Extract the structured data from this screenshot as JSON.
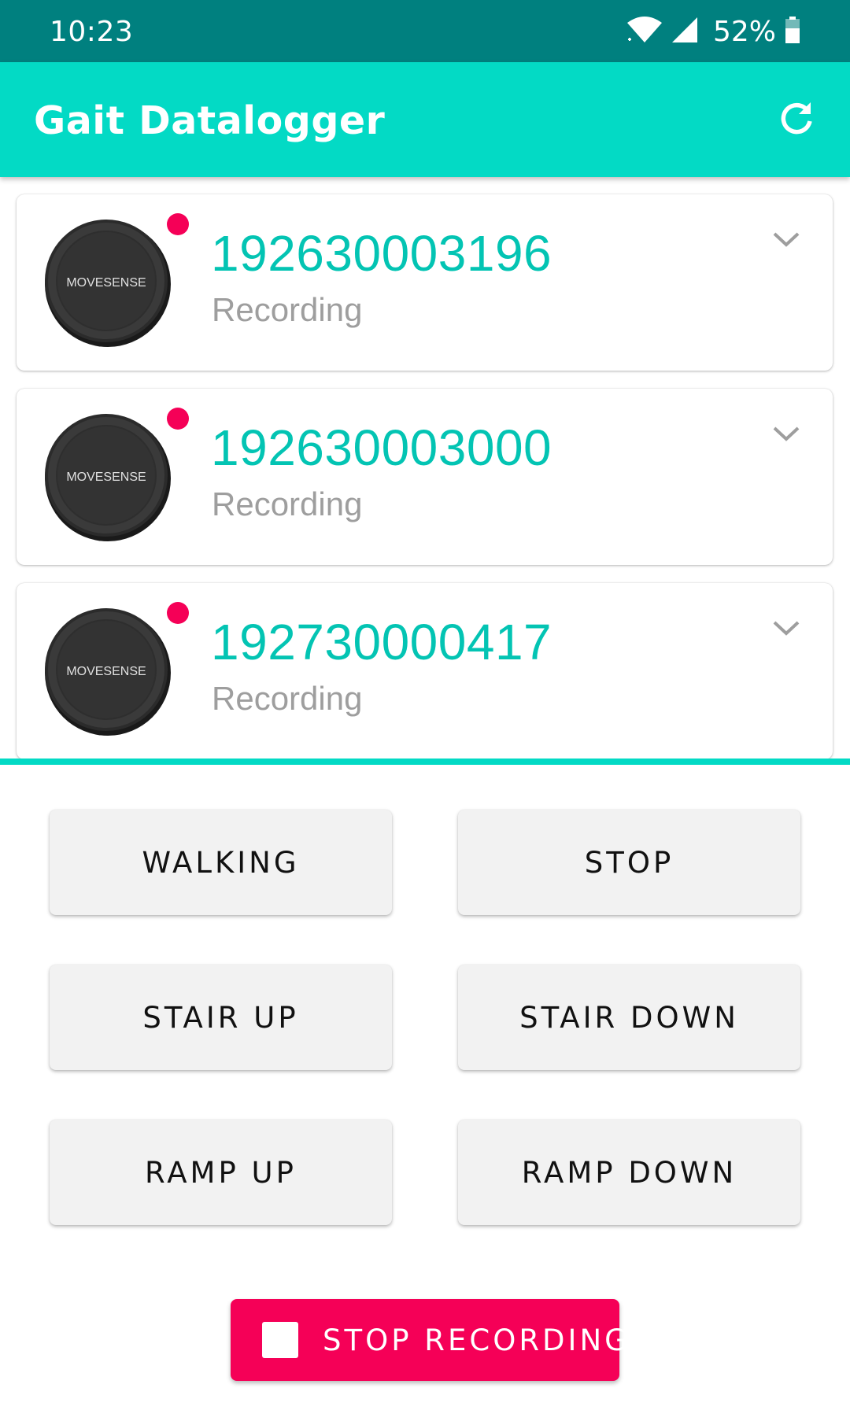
{
  "status_bar": {
    "time": "10:23",
    "battery_percent": "52%",
    "wifi_icon": "wifi-icon",
    "signal_icon": "cell-signal-icon",
    "battery_icon": "battery-icon"
  },
  "app_bar": {
    "title": "Gait Datalogger",
    "refresh_icon": "refresh-icon"
  },
  "devices": [
    {
      "serial": "192630003196",
      "status": "Recording",
      "brand_logo": "MOVESENSE"
    },
    {
      "serial": "192630003000",
      "status": "Recording",
      "brand_logo": "MOVESENSE"
    },
    {
      "serial": "192730000417",
      "status": "Recording",
      "brand_logo": "MOVESENSE"
    }
  ],
  "activities": {
    "walking": "WALKING",
    "stop": "STOP",
    "stair_up": "STAIR UP",
    "stair_down": "STAIR DOWN",
    "ramp_up": "RAMP UP",
    "ramp_down": "RAMP DOWN"
  },
  "stop_recording": {
    "label": "STOP RECORDING",
    "icon": "stop-square-icon"
  },
  "colors": {
    "status_bar": "#00807f",
    "app_bar": "#03dac5",
    "accent_text": "#03c4b3",
    "recording_dot": "#f50057",
    "stop_button": "#f50057",
    "activity_button": "#f2f2f2"
  }
}
